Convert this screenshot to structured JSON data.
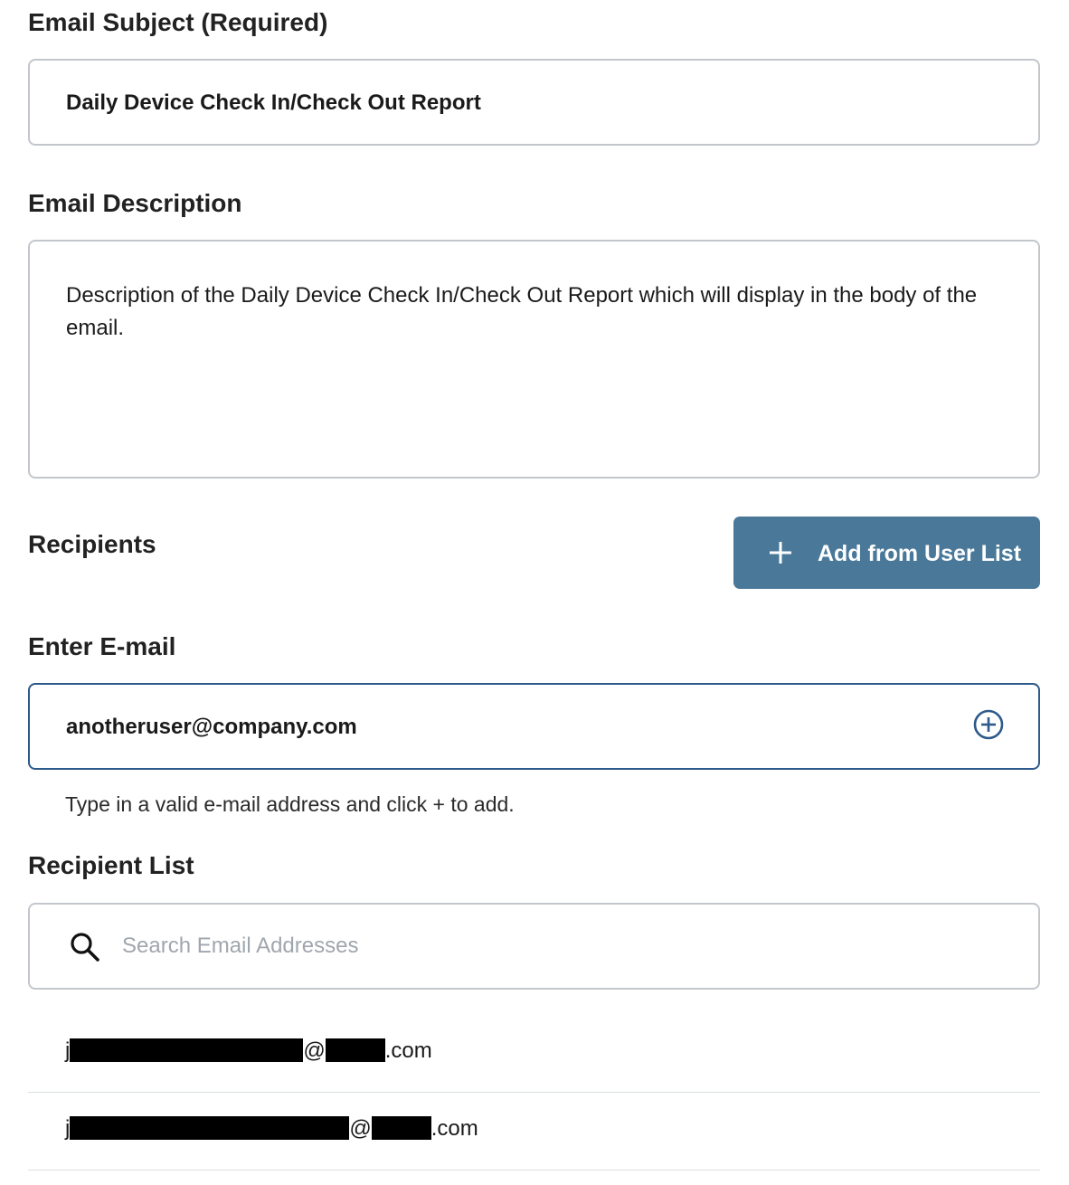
{
  "subject": {
    "label": "Email Subject (Required)",
    "value": "Daily Device Check In/Check Out Report"
  },
  "description": {
    "label": "Email Description",
    "value": "Description of the Daily Device Check In/Check Out Report which will display in the body of the email."
  },
  "recipients": {
    "label": "Recipients",
    "add_button_label": "Add from User List"
  },
  "enter_email": {
    "label": "Enter E-mail",
    "value": "anotheruser@company.com",
    "hint": "Type in a valid e-mail address and click + to add."
  },
  "recipient_list": {
    "label": "Recipient List",
    "search_placeholder": "Search Email Addresses",
    "items": [
      {
        "prefix": "j",
        "at": "@",
        "suffix": ".com"
      },
      {
        "prefix": "j",
        "at": "@",
        "suffix": ".com"
      }
    ]
  },
  "colors": {
    "button_bg": "#4a7899",
    "active_border": "#2d5a8a",
    "field_border": "#c3c7cc"
  }
}
